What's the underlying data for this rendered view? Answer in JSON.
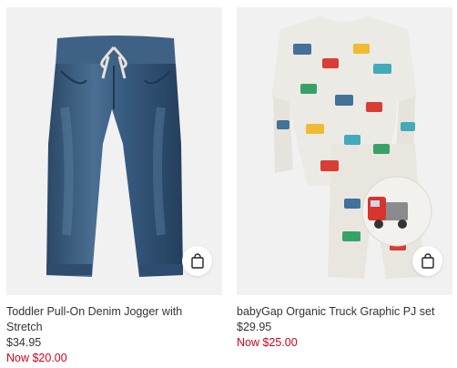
{
  "products": [
    {
      "name": "Toddler Pull-On Denim Jogger with Stretch",
      "price": "$34.95",
      "sale_price": "Now $20.00"
    },
    {
      "name": "babyGap Organic Truck Graphic PJ set",
      "price": "$29.95",
      "sale_price": "Now $25.00"
    }
  ],
  "colors": {
    "sale_red": "#d0021b",
    "text": "#333333",
    "image_bg": "#f1f1f1",
    "denim": "#3a5878"
  },
  "icons": {
    "add_to_bag": "shopping-bag-icon"
  }
}
